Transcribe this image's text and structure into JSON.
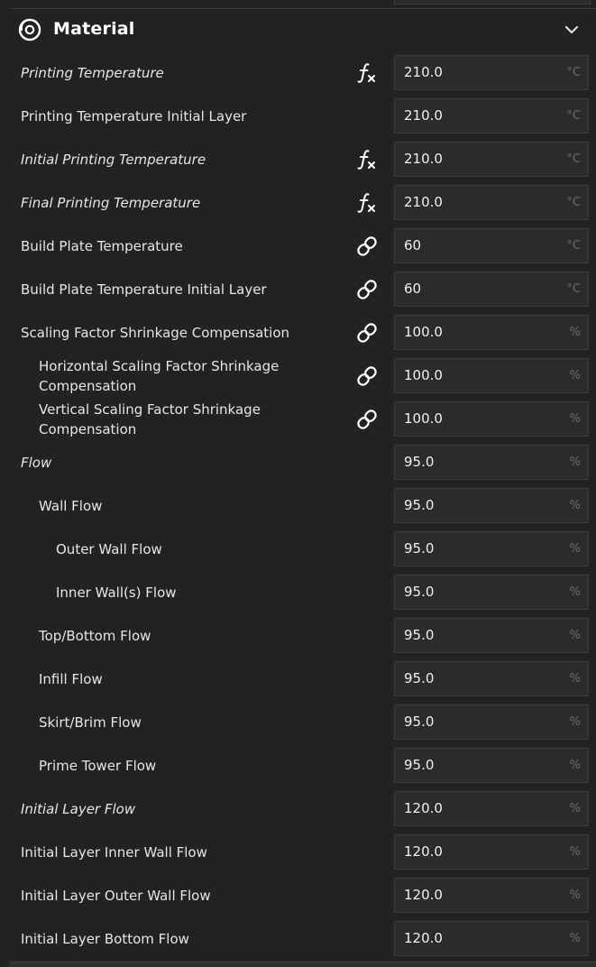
{
  "section": {
    "title": "Material",
    "icon": "spool-icon",
    "collapse_icon": "chevron-down-icon"
  },
  "settings": [
    {
      "label": "Printing Temperature",
      "italic": true,
      "indent": 0,
      "state_icon": "fx",
      "value": "210.0",
      "unit": "°C"
    },
    {
      "label": "Printing Temperature Initial Layer",
      "italic": false,
      "indent": 0,
      "state_icon": "",
      "value": "210.0",
      "unit": "°C"
    },
    {
      "label": "Initial Printing Temperature",
      "italic": true,
      "indent": 0,
      "state_icon": "fx",
      "value": "210.0",
      "unit": "°C"
    },
    {
      "label": "Final Printing Temperature",
      "italic": true,
      "indent": 0,
      "state_icon": "fx",
      "value": "210.0",
      "unit": "°C"
    },
    {
      "label": "Build Plate Temperature",
      "italic": false,
      "indent": 0,
      "state_icon": "link",
      "value": "60",
      "unit": "°C"
    },
    {
      "label": "Build Plate Temperature Initial Layer",
      "italic": false,
      "indent": 0,
      "state_icon": "link",
      "value": "60",
      "unit": "°C"
    },
    {
      "label": "Scaling Factor Shrinkage Compensation",
      "italic": false,
      "indent": 0,
      "state_icon": "link",
      "value": "100.0",
      "unit": "%"
    },
    {
      "label": "Horizontal Scaling Factor Shrinkage\nCompensation",
      "italic": false,
      "indent": 1,
      "state_icon": "link",
      "value": "100.0",
      "unit": "%"
    },
    {
      "label": "Vertical Scaling Factor Shrinkage\nCompensation",
      "italic": false,
      "indent": 1,
      "state_icon": "link",
      "value": "100.0",
      "unit": "%"
    },
    {
      "label": "Flow",
      "italic": true,
      "indent": 0,
      "state_icon": "",
      "value": "95.0",
      "unit": "%"
    },
    {
      "label": "Wall Flow",
      "italic": false,
      "indent": 1,
      "state_icon": "",
      "value": "95.0",
      "unit": "%"
    },
    {
      "label": "Outer Wall Flow",
      "italic": false,
      "indent": 2,
      "state_icon": "",
      "value": "95.0",
      "unit": "%"
    },
    {
      "label": "Inner Wall(s) Flow",
      "italic": false,
      "indent": 2,
      "state_icon": "",
      "value": "95.0",
      "unit": "%"
    },
    {
      "label": "Top/Bottom Flow",
      "italic": false,
      "indent": 1,
      "state_icon": "",
      "value": "95.0",
      "unit": "%"
    },
    {
      "label": "Infill Flow",
      "italic": false,
      "indent": 1,
      "state_icon": "",
      "value": "95.0",
      "unit": "%"
    },
    {
      "label": "Skirt/Brim Flow",
      "italic": false,
      "indent": 1,
      "state_icon": "",
      "value": "95.0",
      "unit": "%"
    },
    {
      "label": "Prime Tower Flow",
      "italic": false,
      "indent": 1,
      "state_icon": "",
      "value": "95.0",
      "unit": "%"
    },
    {
      "label": "Initial Layer Flow",
      "italic": true,
      "indent": 0,
      "state_icon": "",
      "value": "120.0",
      "unit": "%"
    },
    {
      "label": "Initial Layer Inner Wall Flow",
      "italic": false,
      "indent": 0,
      "state_icon": "",
      "value": "120.0",
      "unit": "%"
    },
    {
      "label": "Initial Layer Outer Wall Flow",
      "italic": false,
      "indent": 0,
      "state_icon": "",
      "value": "120.0",
      "unit": "%"
    },
    {
      "label": "Initial Layer Bottom Flow",
      "italic": false,
      "indent": 0,
      "state_icon": "",
      "value": "120.0",
      "unit": "%"
    }
  ],
  "colors": {
    "background": "#222222",
    "field_background": "#2b2b2b",
    "field_border": "#3d3d3d",
    "unit_text": "#6c6c6c"
  }
}
